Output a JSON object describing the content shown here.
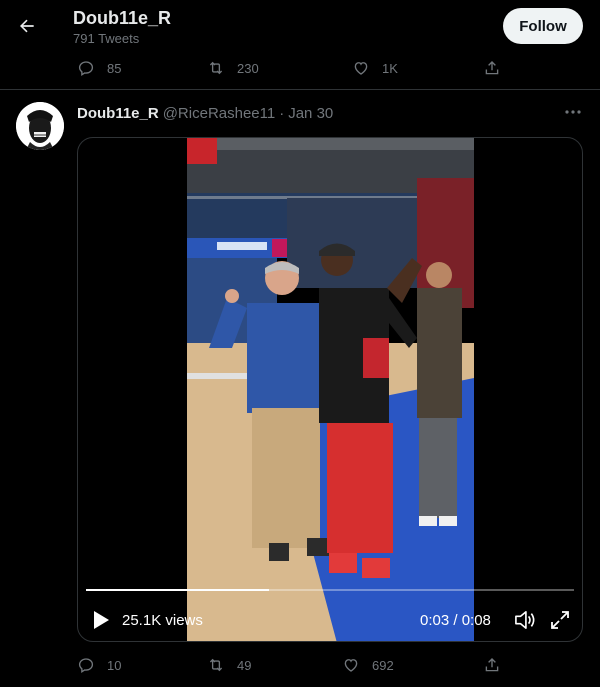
{
  "header": {
    "title": "Doub11e_R",
    "subtitle": "791 Tweets",
    "follow_label": "Follow"
  },
  "prev_tweet_actions": {
    "replies": "85",
    "retweets": "230",
    "likes": "1K"
  },
  "tweet": {
    "author_name": "Doub11e_R",
    "author_handle": "@RiceRashee11",
    "separator": "·",
    "date": "Jan 30",
    "video": {
      "views": "25.1K views",
      "time": "0:03 / 0:08",
      "progress_fraction": 0.375
    },
    "actions": {
      "replies": "10",
      "retweets": "49",
      "likes": "692"
    }
  },
  "icons": [
    "back-arrow-icon",
    "reply-icon",
    "retweet-icon",
    "like-icon",
    "share-icon",
    "more-icon",
    "play-icon",
    "volume-icon",
    "fullscreen-icon"
  ],
  "colors": {
    "background": "#000000",
    "text_primary": "#e7e9ea",
    "text_secondary": "#71767b",
    "follow_button_bg": "#eff3f4",
    "divider": "#2f3336"
  }
}
